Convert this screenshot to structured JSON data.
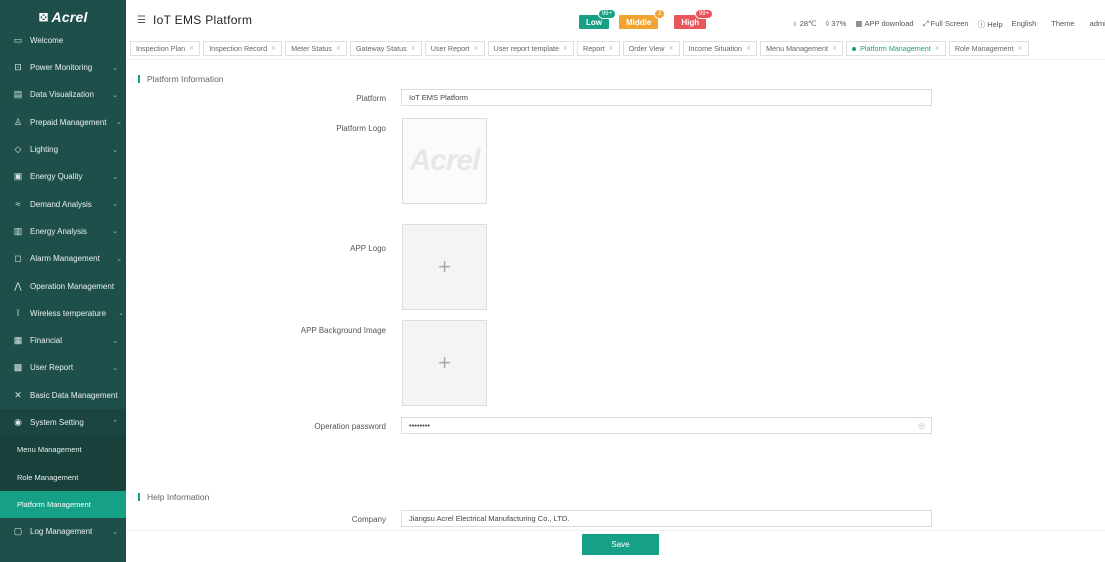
{
  "brand": {
    "logo_text": "Acrel",
    "logo_mark": "⊠",
    "accent": "#16a085",
    "sidebar_bg": "#1f4f4a"
  },
  "header": {
    "title": "IoT EMS Platform",
    "alarms": [
      {
        "label": "Low",
        "count": "99+",
        "color": "#16a085"
      },
      {
        "label": "Middle",
        "count": "3",
        "color": "#f0a430"
      },
      {
        "label": "High",
        "count": "99+",
        "color": "#e8555b"
      }
    ],
    "temperature": "28℃",
    "humidity": "37%",
    "app_download": "APP download",
    "full_screen": "Full Screen",
    "help": "Help",
    "language": "English",
    "theme": "Theme",
    "user": "administrator"
  },
  "sidebar": {
    "items": [
      {
        "label": "Welcome",
        "icon": "monitor-icon"
      },
      {
        "label": "Power Monitoring",
        "icon": "power-icon"
      },
      {
        "label": "Data Visualization",
        "icon": "chart-icon"
      },
      {
        "label": "Prepaid Management",
        "icon": "users-icon"
      },
      {
        "label": "Lighting",
        "icon": "bulb-icon"
      },
      {
        "label": "Energy Quality",
        "icon": "quality-icon"
      },
      {
        "label": "Demand Analysis",
        "icon": "trend-icon"
      },
      {
        "label": "Energy Analysis",
        "icon": "bar-chart-icon"
      },
      {
        "label": "Alarm Management",
        "icon": "bell-icon"
      },
      {
        "label": "Operation Management",
        "icon": "pulse-icon"
      },
      {
        "label": "Wireless temperature",
        "icon": "thermometer-icon"
      },
      {
        "label": "Financial",
        "icon": "finance-icon"
      },
      {
        "label": "User Report",
        "icon": "report-icon"
      },
      {
        "label": "Basic Data Management",
        "icon": "data-icon"
      },
      {
        "label": "System Setting",
        "icon": "settings-icon"
      }
    ],
    "subitems": [
      {
        "label": "Menu Management"
      },
      {
        "label": "Role Management"
      },
      {
        "label": "Platform Management"
      }
    ],
    "last_item": {
      "label": "Log Management",
      "icon": "log-icon"
    }
  },
  "tabs": [
    "Inspection Plan",
    "Inspection Record",
    "Meter Status",
    "Gateway Status",
    "User Report",
    "User report template",
    "Report",
    "Order View",
    "Income Situation",
    "Menu Management",
    "Platform Management",
    "Role Management"
  ],
  "platform": {
    "section_title": "Platform Information",
    "platform_label": "Platform",
    "platform_value": "IoT EMS Platform",
    "logo_label": "Platform Logo",
    "logo_preview_text": "Acrel",
    "app_logo_label": "APP Logo",
    "app_bg_label": "APP Background Image",
    "password_label": "Operation password",
    "password_value": "••••••••",
    "upload_plus": "+"
  },
  "help": {
    "section_title": "Help Information",
    "company_label": "Company",
    "company_value": "Jiangsu Acrel Electrical Manufacturing Co., LTD."
  },
  "footer": {
    "save_label": "Save"
  }
}
